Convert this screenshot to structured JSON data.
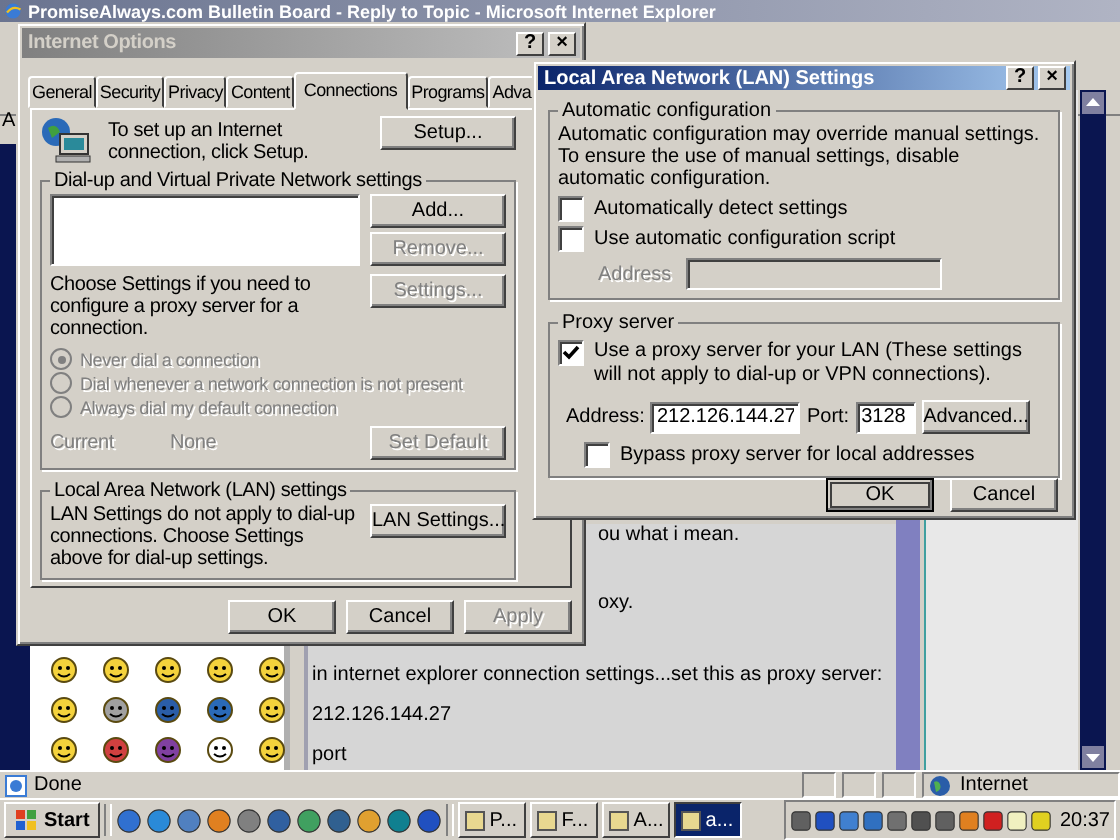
{
  "browser": {
    "title": "PromiseAlways.com Bulletin Board - Reply to Topic - Microsoft Internet Explorer",
    "address_label": "A",
    "page_lines": [
      "ou what i mean.",
      "oxy.",
      "in internet explorer connection settings...set this as proxy server:",
      "212.126.144.27",
      "port"
    ],
    "status": {
      "text": "Done",
      "zone": "Internet"
    }
  },
  "internet_options": {
    "title": "Internet Options",
    "title_buttons": [
      "?",
      "×"
    ],
    "tabs": [
      {
        "label": "General",
        "selected": false
      },
      {
        "label": "Security",
        "selected": false
      },
      {
        "label": "Privacy",
        "selected": false
      },
      {
        "label": "Content",
        "selected": false
      },
      {
        "label": "Connections",
        "selected": true
      },
      {
        "label": "Programs",
        "selected": false
      },
      {
        "label": "Adva",
        "selected": false
      }
    ],
    "setup_text": "To set up an Internet connection, click Setup.",
    "setup_button": "Setup...",
    "dialup_group": "Dial-up and Virtual Private Network settings",
    "list_buttons": [
      {
        "label": "Add...",
        "disabled": false
      },
      {
        "label": "Remove...",
        "disabled": true
      }
    ],
    "settings_text": "Choose Settings if you need to configure a proxy server for a connection.",
    "settings_button": {
      "label": "Settings...",
      "disabled": true
    },
    "radios": [
      {
        "label": "Never dial a connection",
        "selected": true,
        "disabled": true
      },
      {
        "label": "Dial whenever a network connection is not present",
        "selected": false,
        "disabled": true
      },
      {
        "label": "Always dial my default connection",
        "selected": false,
        "disabled": true
      }
    ],
    "current_label": "Current",
    "current_value": "None",
    "set_default": {
      "label": "Set Default",
      "disabled": true
    },
    "lan_group": "Local Area Network (LAN) settings",
    "lan_text": "LAN Settings do not apply to dial-up connections. Choose Settings above for dial-up settings.",
    "lan_button": "LAN Settings...",
    "footer": [
      {
        "label": "OK",
        "disabled": false
      },
      {
        "label": "Cancel",
        "disabled": false
      },
      {
        "label": "Apply",
        "disabled": true
      }
    ]
  },
  "lan_dialog": {
    "title": "Local Area Network (LAN) Settings",
    "title_buttons": [
      "?",
      "×"
    ],
    "auto_group": "Automatic configuration",
    "auto_text": "Automatic configuration may override manual settings.  To ensure the use of manual settings, disable automatic configuration.",
    "auto_options": [
      {
        "label": "Automatically detect settings",
        "checked": false
      },
      {
        "label": "Use automatic configuration script",
        "checked": false
      }
    ],
    "script_address_label": "Address",
    "proxy_group": "Proxy server",
    "proxy_option": {
      "label": "Use a proxy server for your LAN (These settings will not apply to dial-up or VPN connections).",
      "checked": true
    },
    "address_label": "Address:",
    "address_value": "212.126.144.27",
    "port_label": "Port:",
    "port_value": "3128",
    "advanced_button": "Advanced...",
    "bypass_option": {
      "label": "Bypass proxy server for local addresses",
      "checked": false
    },
    "buttons": [
      {
        "label": "OK",
        "default": true
      },
      {
        "label": "Cancel",
        "default": false
      }
    ]
  },
  "taskbar": {
    "start": "Start",
    "tasks": [
      {
        "label": "P...",
        "selected": false
      },
      {
        "label": "F...",
        "selected": false
      },
      {
        "label": "A...",
        "selected": false
      },
      {
        "label": "a...",
        "selected": true
      }
    ],
    "clock": "20:37"
  }
}
